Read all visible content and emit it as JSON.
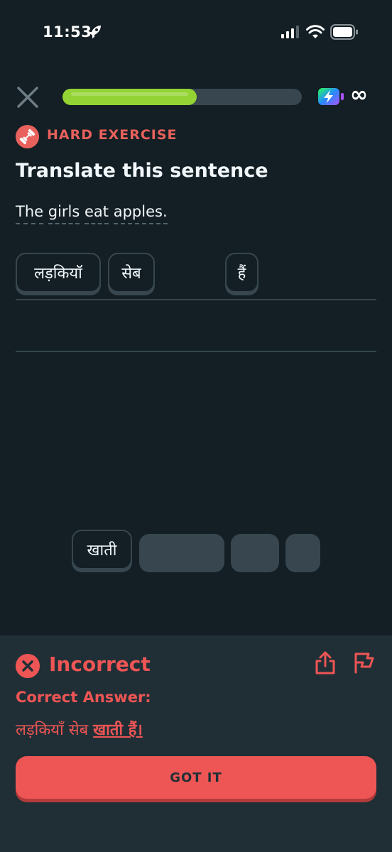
{
  "status_bar": {
    "time": "11:53"
  },
  "progress": {
    "fraction": 0.56
  },
  "lesson": {
    "energy_value": "∞"
  },
  "exercise": {
    "badge": "HARD EXERCISE",
    "title": "Translate this sentence",
    "prompt_words": [
      "The",
      "girls",
      "eat",
      "apples."
    ]
  },
  "answer": {
    "selected_chips": [
      "लड़कियॉ",
      "सेब",
      "हैं"
    ]
  },
  "word_bank": {
    "chips": [
      "खाती"
    ]
  },
  "feedback": {
    "title": "Incorrect",
    "correct_label": "Correct Answer:",
    "answer_plain": "लड़कियाँ सेब",
    "answer_underlined": "खाती हैं।",
    "button_label": "GOT IT"
  },
  "colors": {
    "background": "#131f24",
    "panel": "#202f36",
    "progress_green": "#93d333",
    "error_red": "#ee5555",
    "chip_border": "#37464f"
  },
  "icons": [
    "rocket-icon",
    "signal-icon",
    "wifi-icon",
    "battery-icon",
    "close-icon",
    "energy-icon",
    "dumbbell-icon",
    "error-x-icon",
    "share-icon",
    "flag-icon"
  ]
}
